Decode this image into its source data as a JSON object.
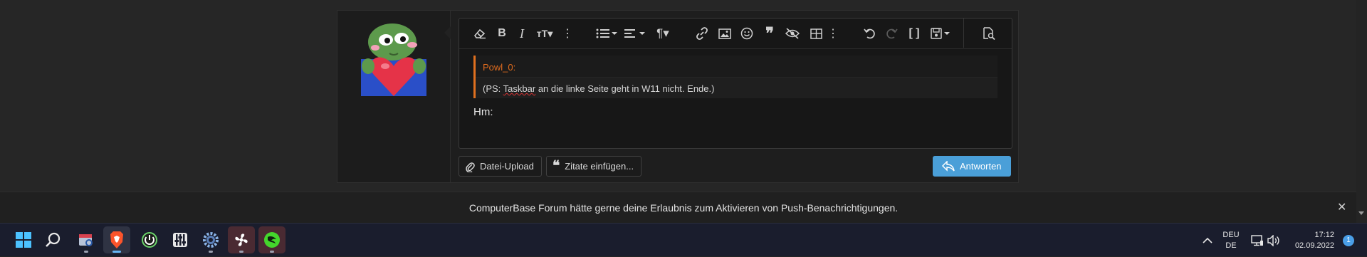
{
  "post": {
    "quote_author": "Powl_0:",
    "quote_text_pre": "(PS: ",
    "quote_text_spell": "Taskbar",
    "quote_text_post": " an die linke Seite geht in W11 nicht. Ende.)",
    "editor_text": "Hm:"
  },
  "toolbar": {
    "icons": [
      "eraser-icon",
      "bold-icon",
      "italic-icon",
      "text-size-icon",
      "more-vertical-icon",
      "list-icon",
      "align-icon",
      "paragraph-icon",
      "link-icon",
      "image-icon",
      "smilie-icon",
      "quote-icon",
      "spoiler-icon",
      "table-icon",
      "more-vertical-icon",
      "undo-icon",
      "redo-icon",
      "bbcode-icon",
      "drafts-icon",
      "preview-icon"
    ]
  },
  "buttons": {
    "upload": "Datei-Upload",
    "insert_quotes": "Zitate einfügen...",
    "reply": "Antworten"
  },
  "notification": {
    "text": "ComputerBase Forum hätte gerne deine Erlaubnis zum Aktivieren von Push-Benachrichtigungen.",
    "close": "✕"
  },
  "taskbar": {
    "apps": [
      "start-icon",
      "search-icon",
      "snipping-tool-icon",
      "brave-browser-icon",
      "hwinfo-icon",
      "audio-mixer-icon",
      "settings-icon",
      "fan-control-icon",
      "razer-icon"
    ],
    "lang_top": "DEU",
    "lang_bottom": "DE",
    "time": "17:12",
    "date": "02.09.2022",
    "notification_count": "1"
  },
  "colors": {
    "accent": "#4a9fd8",
    "quote_accent": "#e0701f",
    "taskbar_bg": "#1a1d2d"
  }
}
